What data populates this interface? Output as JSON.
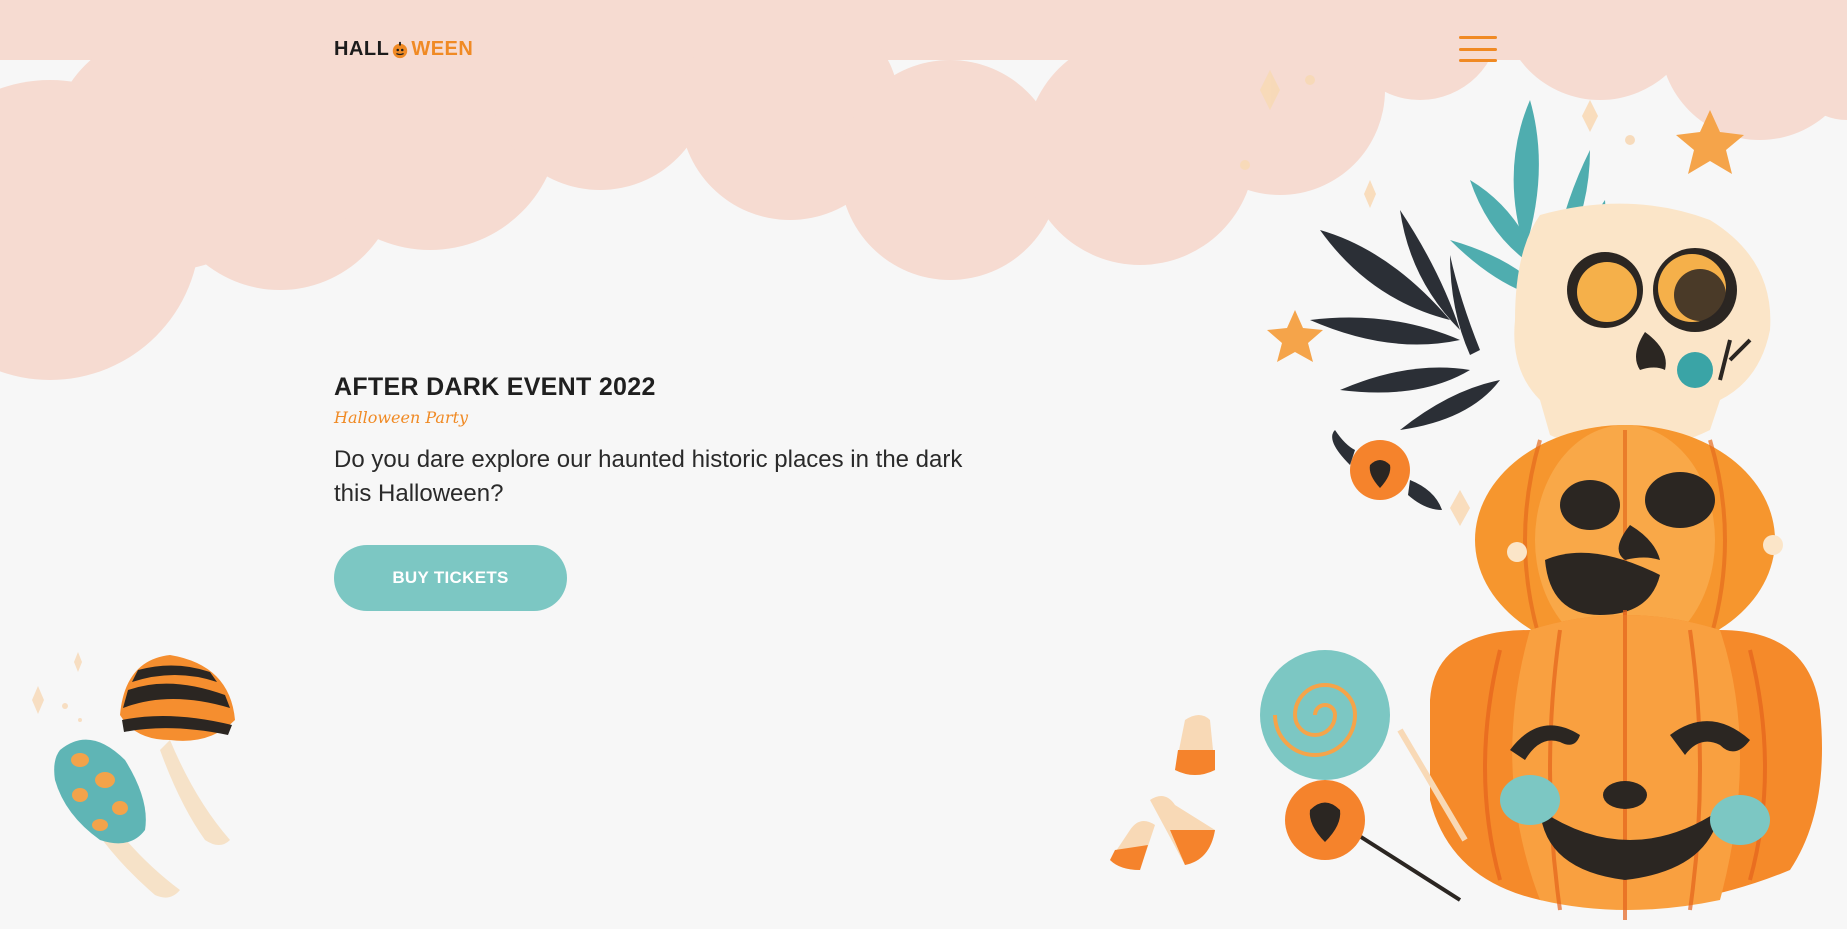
{
  "brand": {
    "logo_prefix": "HALL",
    "logo_suffix": "WEEN",
    "accent": "#f08a24",
    "teal": "#7cc7c3",
    "cloud": "#f6dbd1"
  },
  "nav": {
    "menu_icon": "hamburger-menu-icon"
  },
  "hero": {
    "title": "AFTER DARK EVENT 2022",
    "subtitle": "Halloween Party",
    "description": "Do you dare explore our haunted historic places in the dark this Halloween?",
    "cta_label": "BUY TICKETS"
  },
  "illustrations": {
    "left": "mushrooms-illustration",
    "right": "pumpkins-skull-illustration"
  }
}
